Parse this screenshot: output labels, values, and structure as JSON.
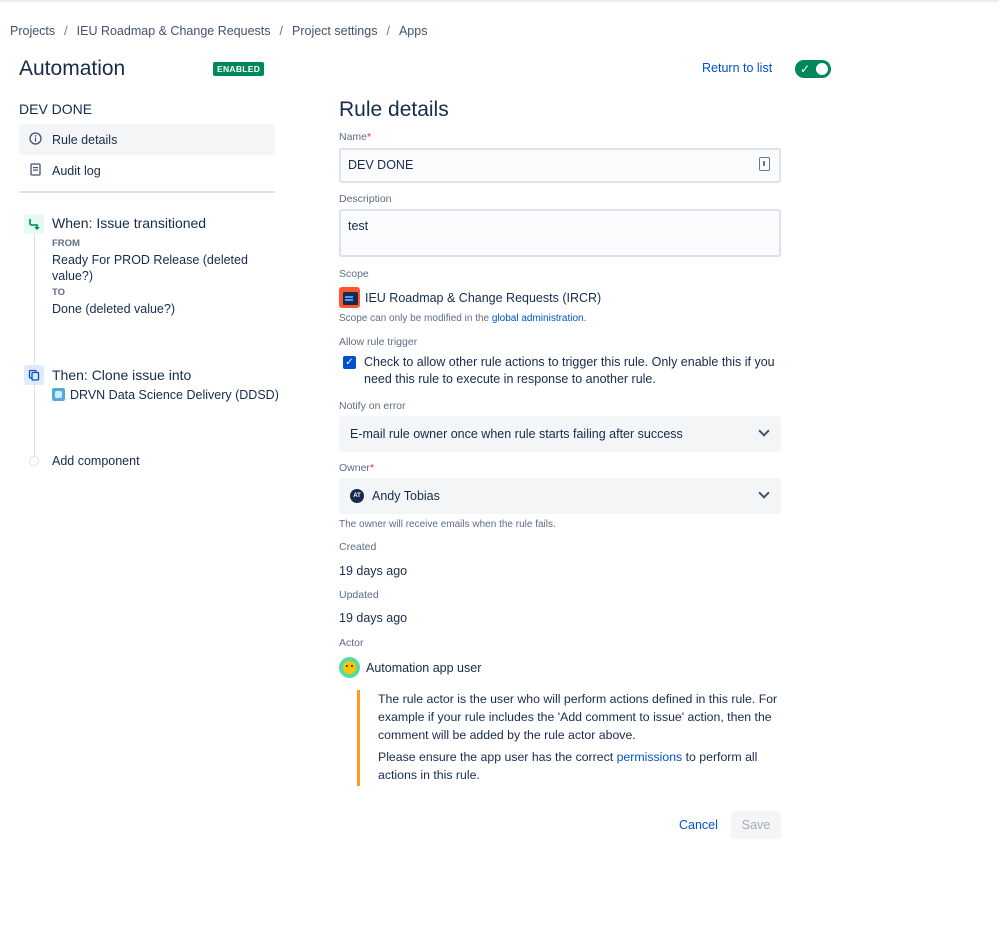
{
  "breadcrumb": [
    "Projects",
    "IEU Roadmap & Change Requests",
    "Project settings",
    "Apps"
  ],
  "header": {
    "title": "Automation",
    "status_badge": "ENABLED",
    "return_link": "Return to list",
    "enabled_toggle": true
  },
  "sidebar": {
    "rule_name": "DEV DONE",
    "nav": [
      {
        "label": "Rule details",
        "icon": "info-icon",
        "active": true
      },
      {
        "label": "Audit log",
        "icon": "document-icon",
        "active": false
      }
    ],
    "trigger": {
      "title": "When: Issue transitioned",
      "from_label": "FROM",
      "from_value": "Ready For PROD Release (deleted value?)",
      "to_label": "TO",
      "to_value": "Done (deleted value?)"
    },
    "action": {
      "title": "Then: Clone issue into",
      "project": "DRVN Data Science Delivery (DDSD)"
    },
    "add_component": "Add component"
  },
  "form": {
    "heading": "Rule details",
    "name_label": "Name",
    "name_value": "DEV DONE",
    "description_label": "Description",
    "description_value": "test",
    "scope_label": "Scope",
    "scope_value": "IEU Roadmap & Change Requests (IRCR)",
    "scope_note": "Scope can only be modified in the",
    "scope_note_link": "global administration",
    "scope_note_end": ".",
    "trigger_label": "Allow rule trigger",
    "trigger_text": "Check to allow other rule actions to trigger this rule. Only enable this if you need this rule to execute in response to another rule.",
    "trigger_checked": true,
    "notify_label": "Notify on error",
    "notify_value": "E-mail rule owner once when rule starts failing after success",
    "owner_label": "Owner",
    "owner_initials": "AT",
    "owner_value": "Andy Tobias",
    "owner_note": "The owner will receive emails when the rule fails.",
    "created_label": "Created",
    "created_value": "19 days ago",
    "updated_label": "Updated",
    "updated_value": "19 days ago",
    "actor_label": "Actor",
    "actor_value": "Automation app user",
    "actor_note_1": "The rule actor is the user who will perform actions defined in this rule. For example if your rule includes the 'Add comment to issue' action, then the comment will be added by the rule actor above.",
    "actor_note_2_pre": "Please ensure the app user has the correct",
    "actor_note_2_link": "permissions",
    "actor_note_2_post": "to perform all actions in this rule.",
    "cancel_label": "Cancel",
    "save_label": "Save"
  },
  "colors": {
    "accent": "#0052cc",
    "success": "#00875a",
    "warning_border": "#ff991f"
  }
}
